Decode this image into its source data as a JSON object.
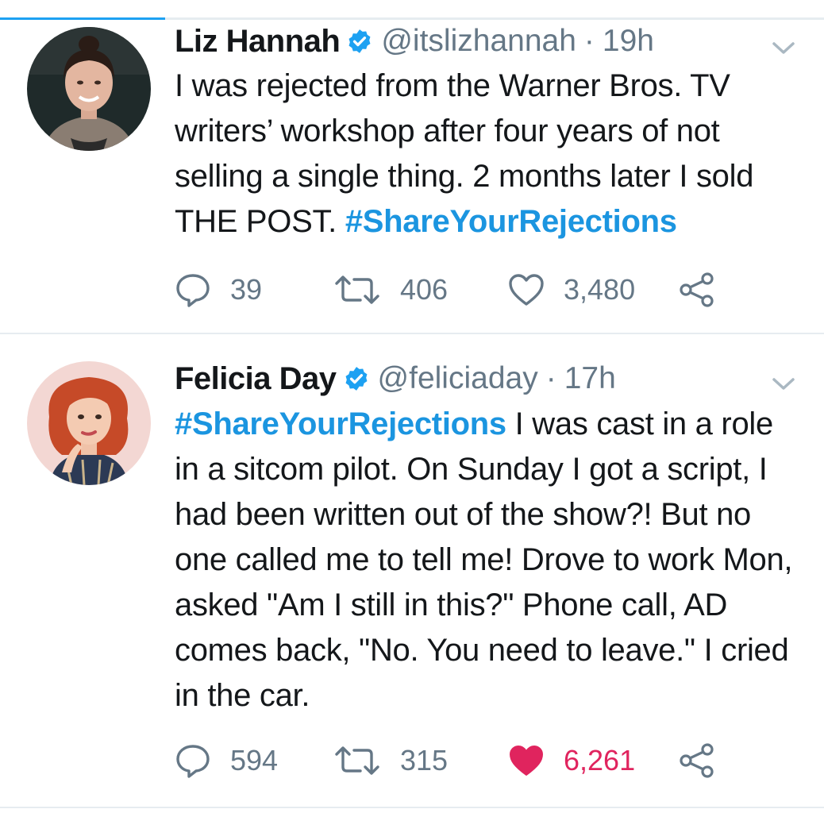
{
  "progress": {
    "fraction": 0.2,
    "color": "#1da1f2"
  },
  "tweets": [
    {
      "author": "Liz Hannah",
      "handle": "@itslizhannah",
      "separator": "·",
      "time": "19h",
      "avatar_icon": "woman-avatar-dark-hair",
      "text": [
        {
          "t": "I was rejected from the Warner Bros. TV writers’ workshop after four years of not selling a single thing. 2 months later I sold THE POST. "
        },
        {
          "t": "#ShareYourRejections",
          "hashtag": true
        }
      ],
      "replies": "39",
      "retweets": "406",
      "likes": "3,480",
      "liked": false
    },
    {
      "author": "Felicia Day",
      "handle": "@feliciaday",
      "separator": "·",
      "time": "17h",
      "avatar_icon": "woman-avatar-red-hair",
      "text": [
        {
          "t": "#ShareYourRejections",
          "hashtag": true
        },
        {
          "t": " I was cast in a role in a sitcom pilot. On Sunday I got a script, I had been written out of the show?! But no one called me to tell me! Drove to work Mon, asked \"Am I still in this?\" Phone call, AD comes back, \"No. You need to leave.\" I cried in the car."
        }
      ],
      "replies": "594",
      "retweets": "315",
      "likes": "6,261",
      "liked": true
    }
  ],
  "colors": {
    "accent": "#1da1f2",
    "hashtag": "#1b95e0",
    "muted": "#657786",
    "like_active": "#e0245e"
  }
}
